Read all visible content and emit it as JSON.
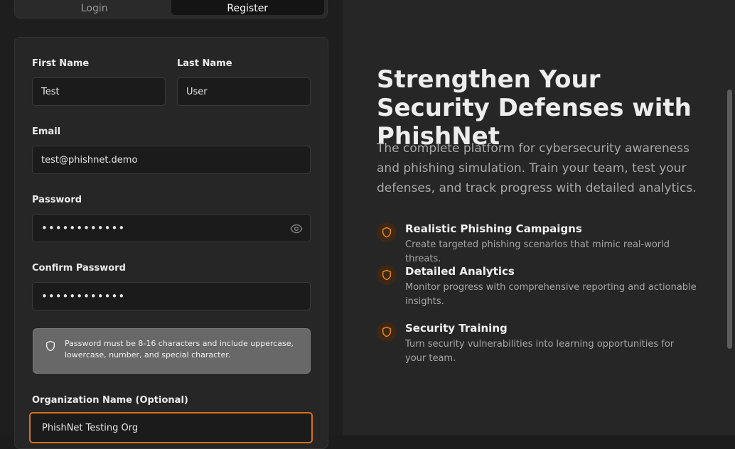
{
  "tabs": [
    {
      "label": "Login"
    },
    {
      "label": "Register"
    }
  ],
  "form": {
    "first_name": {
      "label": "First Name",
      "value": "Test"
    },
    "last_name": {
      "label": "Last Name",
      "value": "User"
    },
    "email": {
      "label": "Email",
      "value": "test@phishnet.demo"
    },
    "password": {
      "label": "Password",
      "value": "••••••••••••"
    },
    "confirm_password": {
      "label": "Confirm Password",
      "value": "••••••••••••"
    },
    "hint": "Password must be 8-16 characters and include uppercase, lowercase, number, and special character.",
    "organization": {
      "label": "Organization Name (Optional)",
      "value": "PhishNet Testing Org"
    }
  },
  "hero": {
    "headline": "Strengthen Your Security Defenses with PhishNet",
    "intro": "The complete platform for cybersecurity awareness and phishing simulation. Train your team, test your defenses, and track progress with detailed analytics.",
    "features": [
      {
        "title": "Realistic Phishing Campaigns",
        "desc": "Create targeted phishing scenarios that mimic real-world threats.",
        "icon": "shield-icon"
      },
      {
        "title": "Detailed Analytics",
        "desc": "Monitor progress with comprehensive reporting and actionable insights.",
        "icon": "shield-icon"
      },
      {
        "title": "Security Training",
        "desc": "Turn security vulnerabilities into learning opportunities for your team.",
        "icon": "shield-icon"
      }
    ]
  },
  "colors": {
    "accent": "#d97316",
    "background": "#1e1e1e",
    "panel": "#262626"
  }
}
